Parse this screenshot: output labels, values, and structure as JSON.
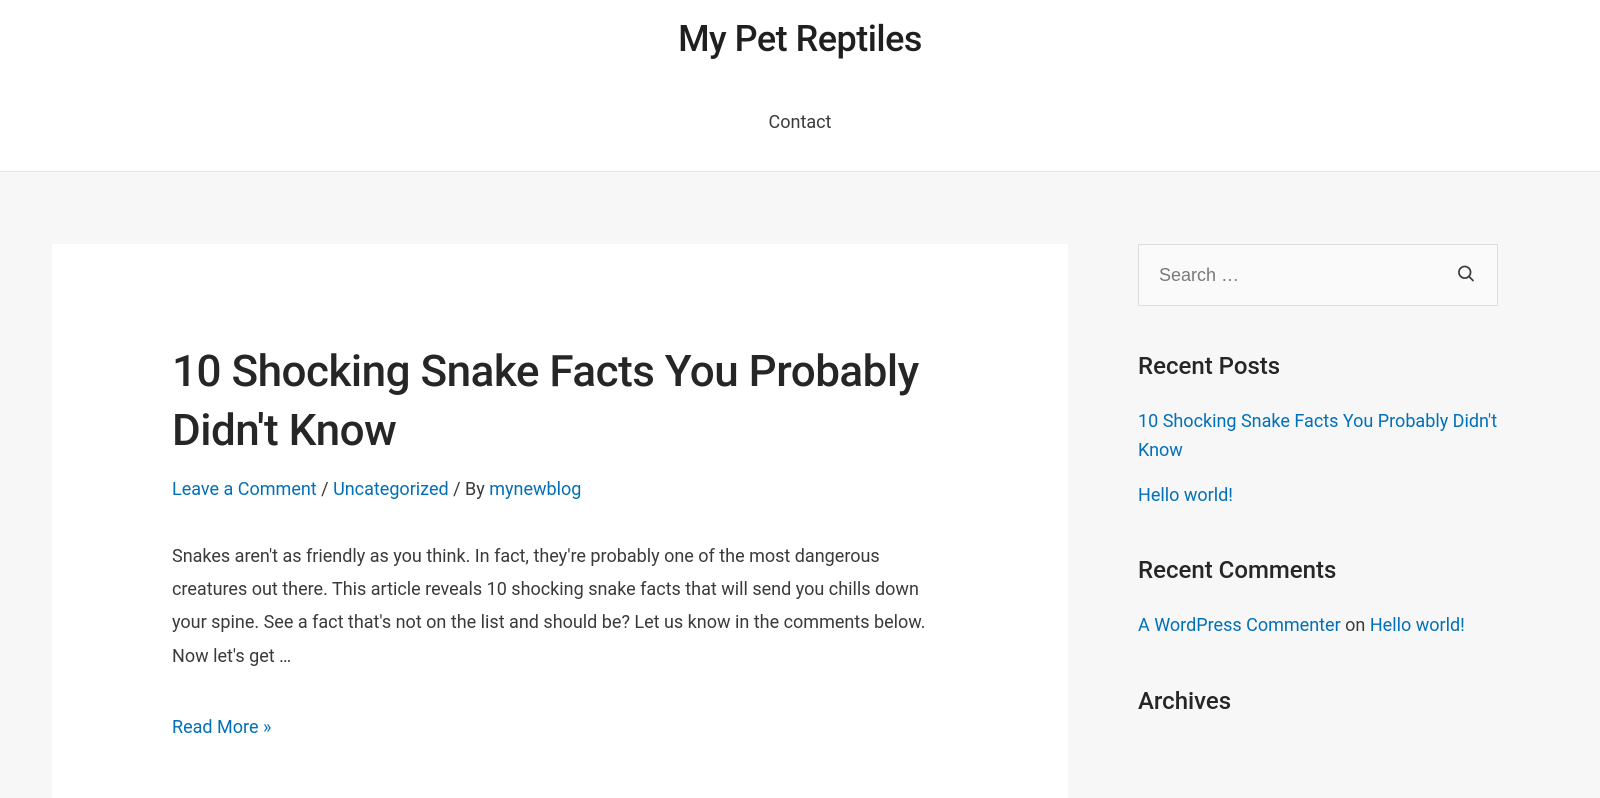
{
  "site": {
    "title": "My Pet Reptiles"
  },
  "nav": {
    "items": [
      {
        "label": "Contact"
      }
    ]
  },
  "post": {
    "title": "10 Shocking Snake Facts You Probably Didn't Know",
    "meta": {
      "comments_link": "Leave a Comment",
      "sep1": " / ",
      "category": "Uncategorized",
      "by_sep": " / By ",
      "author": "mynewblog"
    },
    "excerpt": "Snakes aren't as friendly as you think. In fact, they're probably one of the most dangerous creatures out there. This article reveals 10 shocking snake facts that will send you chills down your spine. See a fact that's not on the list and should be? Let us know in the comments below. Now let's get …",
    "read_more": "Read More »"
  },
  "sidebar": {
    "search": {
      "placeholder": "Search …"
    },
    "recent_posts": {
      "title": "Recent Posts",
      "items": [
        {
          "label": "10 Shocking Snake Facts You Probably Didn't Know"
        },
        {
          "label": "Hello world!"
        }
      ]
    },
    "recent_comments": {
      "title": "Recent Comments",
      "items": [
        {
          "author": "A WordPress Commenter",
          "on": " on ",
          "post": "Hello world!"
        }
      ]
    },
    "archives": {
      "title": "Archives"
    }
  }
}
